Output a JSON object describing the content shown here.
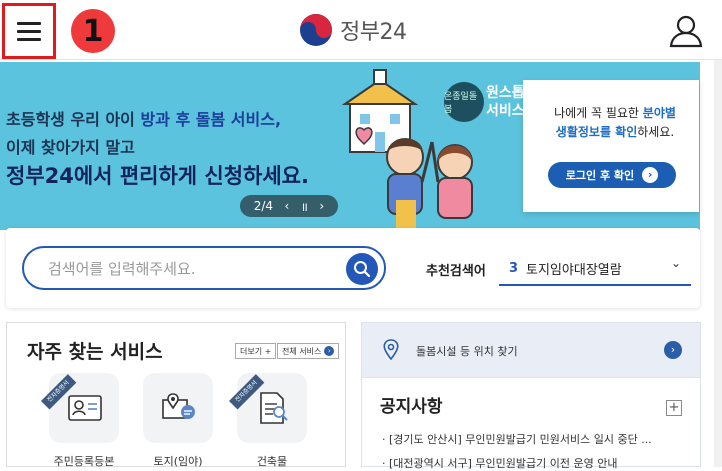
{
  "header": {
    "step_number": "1",
    "logo_text": "정부24"
  },
  "banner": {
    "line1_a": "초등학생 우리 아이 ",
    "line1_b": "방과 후 돌봄 서비스,",
    "line2": "이제 찾아가지 말고",
    "line3": "정부24에서 편리하게 신청하세요.",
    "badge_text": "온종일돌봄",
    "wing_text_1": "원스톱",
    "wing_text_2": "서비스",
    "pager": {
      "current": "2/4",
      "prev": "‹",
      "pause": "॥",
      "next": "›"
    }
  },
  "login_card": {
    "msg_a": "나에게 꼭 필요한 ",
    "msg_hl1": "분야별",
    "msg_hl2": "생활정보를 확인",
    "msg_b": "하세요.",
    "button_label": "로그인 후 확인",
    "button_arrow": "›"
  },
  "search": {
    "placeholder": "검색어를 입력해주세요.",
    "recommend_label": "추천검색어",
    "recommend_num": "3",
    "recommend_value": "토지임야대장열람",
    "chevron": "⌄"
  },
  "frequent": {
    "title": "자주 찾는 서비스",
    "more": "더보기 +",
    "all": "전체 서비스",
    "all_icon": "›",
    "ribbon": "전자증명서",
    "items": [
      {
        "label": "주민등록등본",
        "icon": "id-card-icon"
      },
      {
        "label": "토지(임야)",
        "icon": "map-pin-chat-icon"
      },
      {
        "label": "건축물",
        "icon": "document-search-icon"
      }
    ]
  },
  "locate": {
    "text": "돌봄시설 등 위치 찾기",
    "go": "›"
  },
  "notice": {
    "title": "공지사항",
    "plus": "+",
    "items": [
      "· [경기도 안산시] 무인민원발급기 민원서비스 일시 중단 ...",
      "· [대전광역시 서구] 무인민원발급기 이전 운영 안내"
    ]
  },
  "colors": {
    "accent": "#2458b8",
    "banner_bg": "#5cc3de",
    "highlight_border": "#e01b1b",
    "badge": "#ee3a3a"
  }
}
